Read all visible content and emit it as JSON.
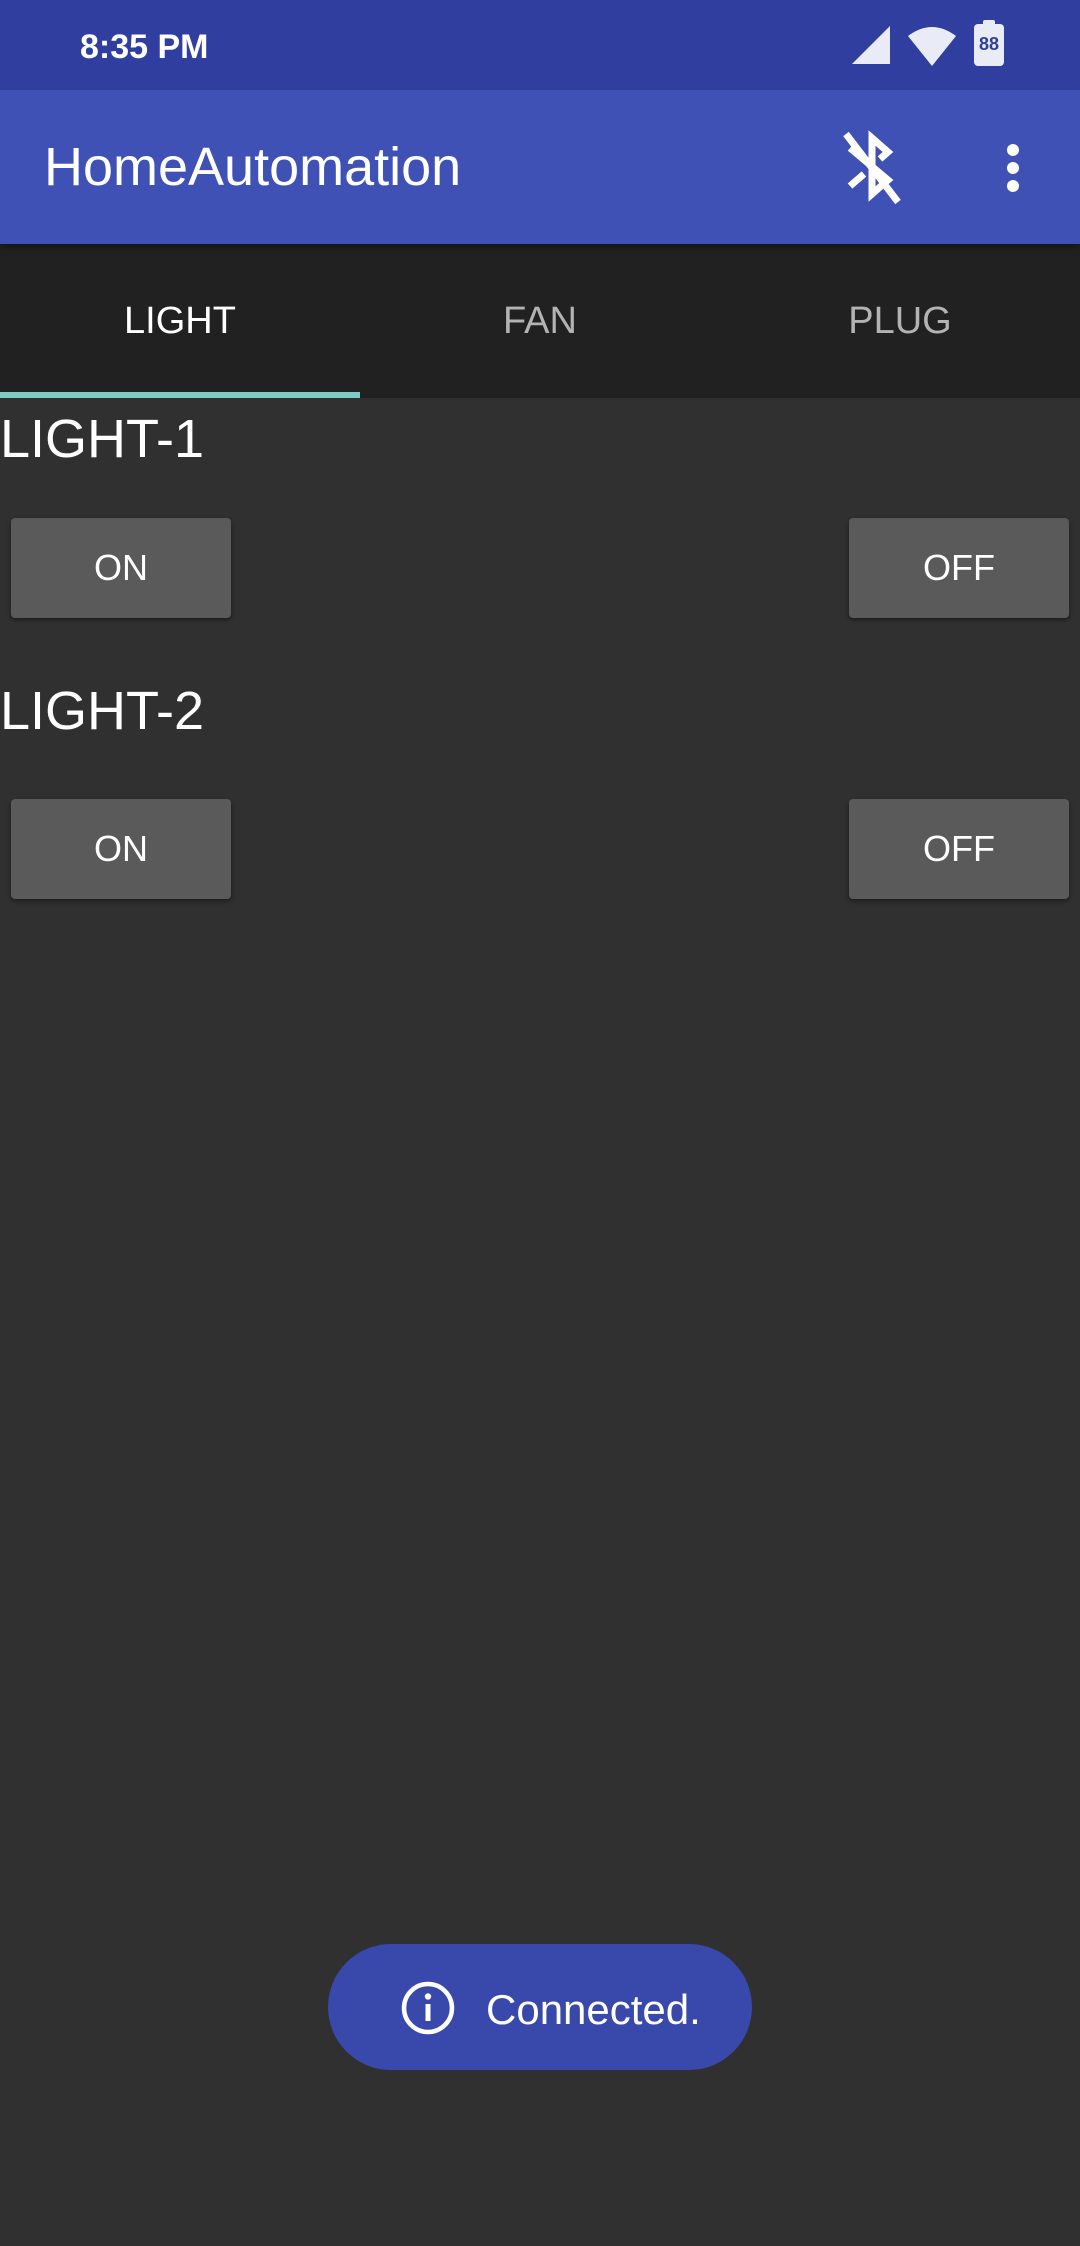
{
  "status_bar": {
    "time": "8:35 PM",
    "battery_level": "88",
    "signal_icon": "signal-icon",
    "wifi_icon": "wifi-icon",
    "battery_icon": "battery-icon"
  },
  "app_bar": {
    "title": "HomeAutomation",
    "bluetooth_icon": "bluetooth-disabled-icon",
    "more_icon": "more-vert-icon"
  },
  "tabs": [
    {
      "label": "LIGHT",
      "active": true
    },
    {
      "label": "FAN",
      "active": false
    },
    {
      "label": "PLUG",
      "active": false
    }
  ],
  "sections": [
    {
      "title": "LIGHT-1",
      "on_label": "ON",
      "off_label": "OFF"
    },
    {
      "title": "LIGHT-2",
      "on_label": "ON",
      "off_label": "OFF"
    }
  ],
  "toast": {
    "text": "Connected.",
    "icon": "info-icon"
  },
  "colors": {
    "status_bar": "#303F9F",
    "app_bar": "#3F51B5",
    "tab_bar": "#212121",
    "tab_indicator": "#80CBC4",
    "background": "#303030",
    "button": "#5A5A5A",
    "toast": "#3949AB"
  }
}
